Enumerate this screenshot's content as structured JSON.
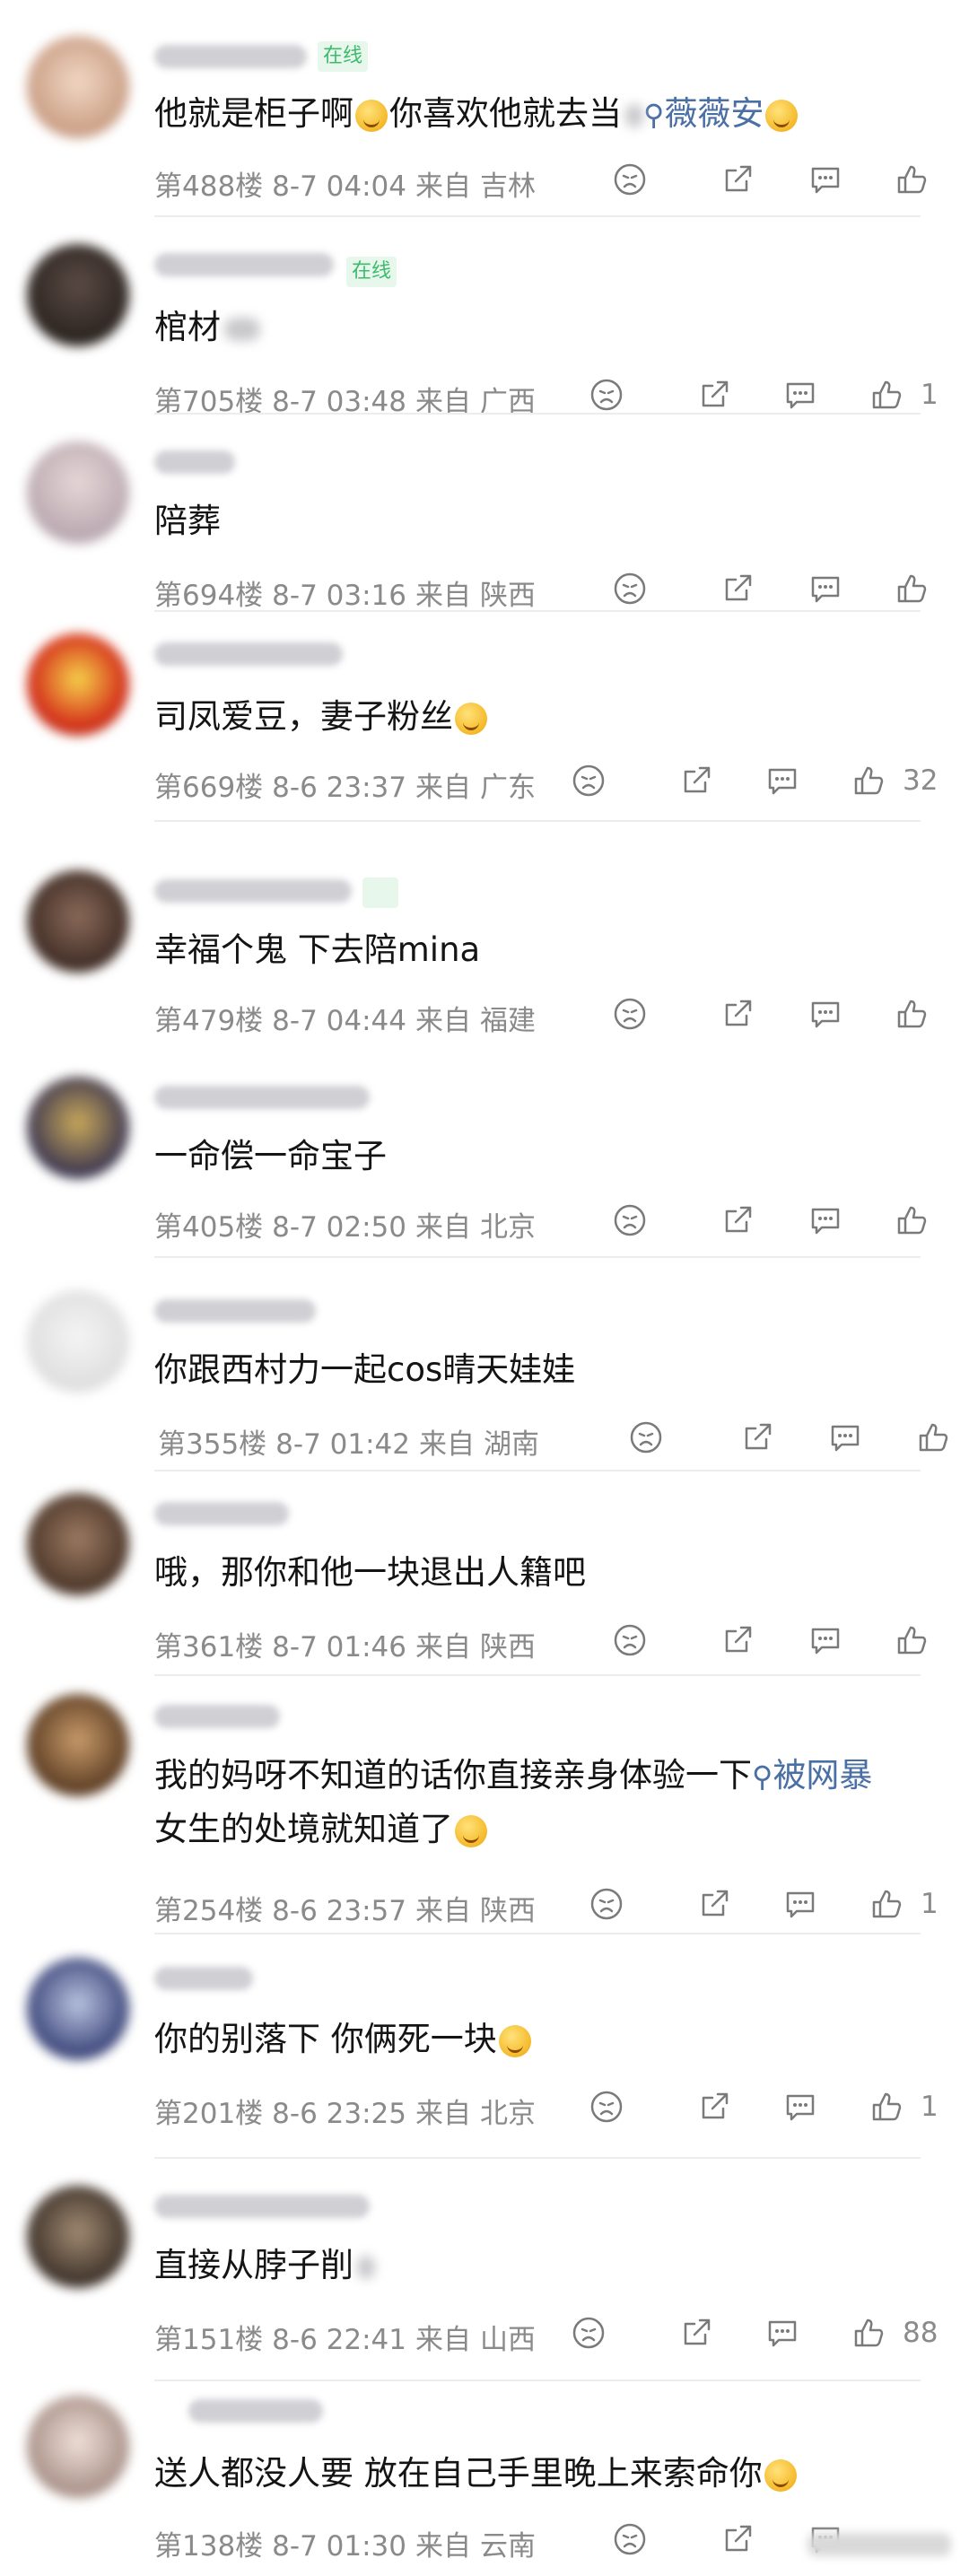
{
  "online_label": "在线",
  "comments": [
    {
      "content": "他就是柜子啊",
      "after": "你喜欢他就去当",
      "link": "薇薇安",
      "floor": "第488楼",
      "time": "8-7 04:04",
      "from": "来自",
      "region": "吉林",
      "likes": ""
    },
    {
      "content": "棺材",
      "floor": "第705楼",
      "time": "8-7 03:48",
      "from": "来自",
      "region": "广西",
      "likes": "1"
    },
    {
      "content": "陪葬",
      "floor": "第694楼",
      "time": "8-7 03:16",
      "from": "来自",
      "region": "陕西",
      "likes": ""
    },
    {
      "content": "司凤爱豆，妻子粉丝",
      "floor": "第669楼",
      "time": "8-6 23:37",
      "from": "来自",
      "region": "广东",
      "likes": "32"
    },
    {
      "content": "幸福个鬼 下去陪mina",
      "floor": "第479楼",
      "time": "8-7 04:44",
      "from": "来自",
      "region": "福建",
      "likes": ""
    },
    {
      "content": "一命偿一命宝子",
      "floor": "第405楼",
      "time": "8-7 02:50",
      "from": "来自",
      "region": "北京",
      "likes": ""
    },
    {
      "content": "你跟西村力一起cos晴天娃娃",
      "floor": "第355楼",
      "time": "8-7 01:42",
      "from": "来自",
      "region": "湖南",
      "likes": ""
    },
    {
      "content": "哦，那你和他一块退出人籍吧",
      "floor": "第361楼",
      "time": "8-7 01:46",
      "from": "来自",
      "region": "陕西",
      "likes": ""
    },
    {
      "content": "我的妈呀不知道的话你直接亲身体验一下",
      "link": "被网暴",
      "content2": "女生的处境就知道了",
      "floor": "第254楼",
      "time": "8-6 23:57",
      "from": "来自",
      "region": "陕西",
      "likes": "1"
    },
    {
      "content": "你的别落下 你俩死一块",
      "floor": "第201楼",
      "time": "8-6 23:25",
      "from": "来自",
      "region": "北京",
      "likes": "1"
    },
    {
      "content": "直接从脖子削",
      "floor": "第151楼",
      "time": "8-6 22:41",
      "from": "来自",
      "region": "山西",
      "likes": "88"
    },
    {
      "content": "送人都没人要 放在自己手里晚上来索命你",
      "floor": "第138楼",
      "time": "8-7 01:30",
      "from": "来自",
      "region": "云南",
      "likes": ""
    }
  ],
  "icons": [
    "dislike-icon",
    "share-icon",
    "comment-icon",
    "like-icon"
  ],
  "colors": {
    "meta": "#8a8a8a",
    "link": "#4a6fa5",
    "online": "#3dbb6c"
  }
}
